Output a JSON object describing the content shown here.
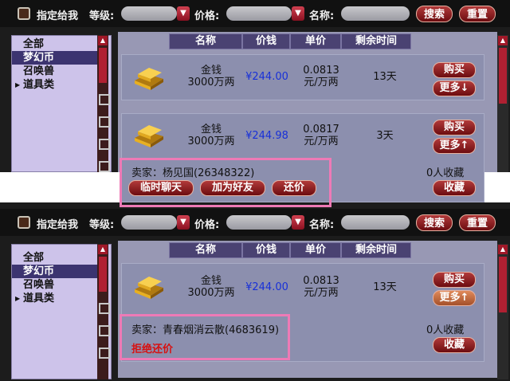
{
  "search": {
    "checkbox_label": "指定给我",
    "level_label": "等级:",
    "price_label": "价格:",
    "name_label": "名称:",
    "search_button": "搜索",
    "reset_button": "重置"
  },
  "categories": [
    "全部",
    "梦幻币",
    "召唤兽",
    "道具类"
  ],
  "selected_category": "梦幻币",
  "columns": [
    "名称",
    "价钱",
    "单价",
    "剩余时间"
  ],
  "panel1": {
    "listings": [
      {
        "name": "金钱",
        "amount": "3000万两",
        "price": "¥244.00",
        "unit_price": "0.0813",
        "unit": "元/万两",
        "time_left": "13天",
        "buy_label": "购买",
        "more_label": "更多↓"
      },
      {
        "name": "金钱",
        "amount": "3000万两",
        "price": "¥244.98",
        "unit_price": "0.0817",
        "unit": "元/万两",
        "time_left": "3天",
        "buy_label": "购买",
        "more_label": "更多↑"
      }
    ],
    "seller": "卖家：杨见国(26348322)",
    "favorites": "0人收藏",
    "chat_button": "临时聊天",
    "friend_button": "加为好友",
    "bargain_button": "还价",
    "collect_button": "收藏"
  },
  "panel2": {
    "listings": [
      {
        "name": "金钱",
        "amount": "3000万两",
        "price": "¥244.00",
        "unit_price": "0.0813",
        "unit": "元/万两",
        "time_left": "13天",
        "buy_label": "购买",
        "more_label": "更多↑"
      }
    ],
    "seller": "卖家：青春烟消云散(4683619)",
    "favorites": "0人收藏",
    "refuse_text": "拒绝还价",
    "collect_button": "收藏"
  },
  "colors": {
    "background": "#1c1c1c",
    "category_panel": "#cdc3ea",
    "selected_category_bg": "#3c3470",
    "content_bg": "#9898b4",
    "button_red": "#8c1420",
    "price_blue": "#1830d8",
    "refuse_red": "#d81010",
    "highlight_pink": "#ee7ab6"
  },
  "icons": [
    "gold-ingot-icon",
    "dropdown-arrow-icon",
    "scroll-up-icon",
    "submenu-arrow-icon"
  ]
}
